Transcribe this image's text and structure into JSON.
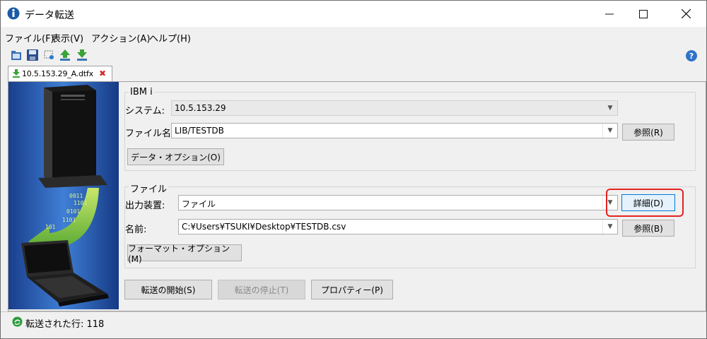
{
  "window": {
    "title": "データ転送"
  },
  "menu": [
    "ファイル(F)",
    "表示(V)",
    "アクション(A)",
    "ヘルプ(H)"
  ],
  "tab": {
    "label": "10.5.153.29_A.dtfx"
  },
  "ibmi": {
    "group_title": "IBM i",
    "system_label": "システム:",
    "system_value": "10.5.153.29",
    "file_label": "ファイル名:",
    "file_value": "LIB/TESTDB",
    "browse_label": "参照(R)",
    "data_options_label": "データ・オプション(O)"
  },
  "file": {
    "group_title": "ファイル",
    "output_label": "出力装置:",
    "output_value": "ファイル",
    "details_label": "詳細(D)",
    "name_label": "名前:",
    "name_value": "C:¥Users¥TSUKI¥Desktop¥TESTDB.csv",
    "browse_label": "参照(B)",
    "format_options_label": "フォーマット・オプション(M)"
  },
  "actions": {
    "start_label": "転送の開始(S)",
    "stop_label": "転送の停止(T)",
    "properties_label": "プロパティー(P)"
  },
  "status": {
    "text": "転送された行: 118"
  },
  "colors": {
    "highlight": "#e52222",
    "accent": "#0078d7"
  }
}
